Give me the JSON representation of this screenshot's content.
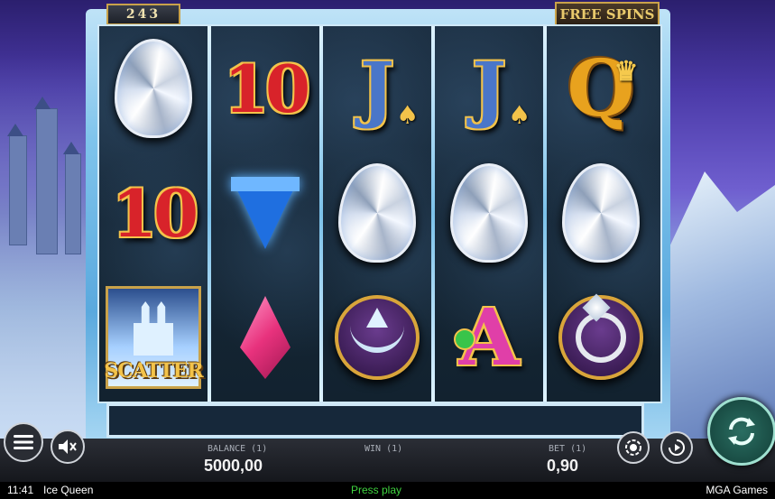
{
  "game": {
    "ways_counter": "243",
    "free_spins_label": "FREE SPINS"
  },
  "reels": [
    [
      {
        "symbol": "egg-diamond"
      },
      {
        "symbol": "ten",
        "text": "10"
      },
      {
        "symbol": "scatter",
        "text": "SCATTER"
      }
    ],
    [
      {
        "symbol": "ten",
        "text": "10"
      },
      {
        "symbol": "sapphire"
      },
      {
        "symbol": "ruby"
      }
    ],
    [
      {
        "symbol": "jack",
        "text": "J"
      },
      {
        "symbol": "egg-diamond"
      },
      {
        "symbol": "tiara"
      }
    ],
    [
      {
        "symbol": "jack",
        "text": "J"
      },
      {
        "symbol": "egg-diamond"
      },
      {
        "symbol": "ace",
        "text": "A"
      }
    ],
    [
      {
        "symbol": "queen",
        "text": "Q"
      },
      {
        "symbol": "egg-diamond"
      },
      {
        "symbol": "ring"
      }
    ]
  ],
  "controls": {
    "balance_label": "BALANCE (1)",
    "balance_value": "5000,00",
    "win_label": "WIN (1)",
    "bet_label": "BET (1)",
    "bet_value": "0,90"
  },
  "footer": {
    "time": "11:41",
    "game_name": "Ice Queen",
    "status": "Press play",
    "provider": "MGA Games"
  },
  "colors": {
    "status_green": "#3fd33f",
    "frame_ice": "#7fc4ec",
    "gold": "#c9a24a"
  }
}
